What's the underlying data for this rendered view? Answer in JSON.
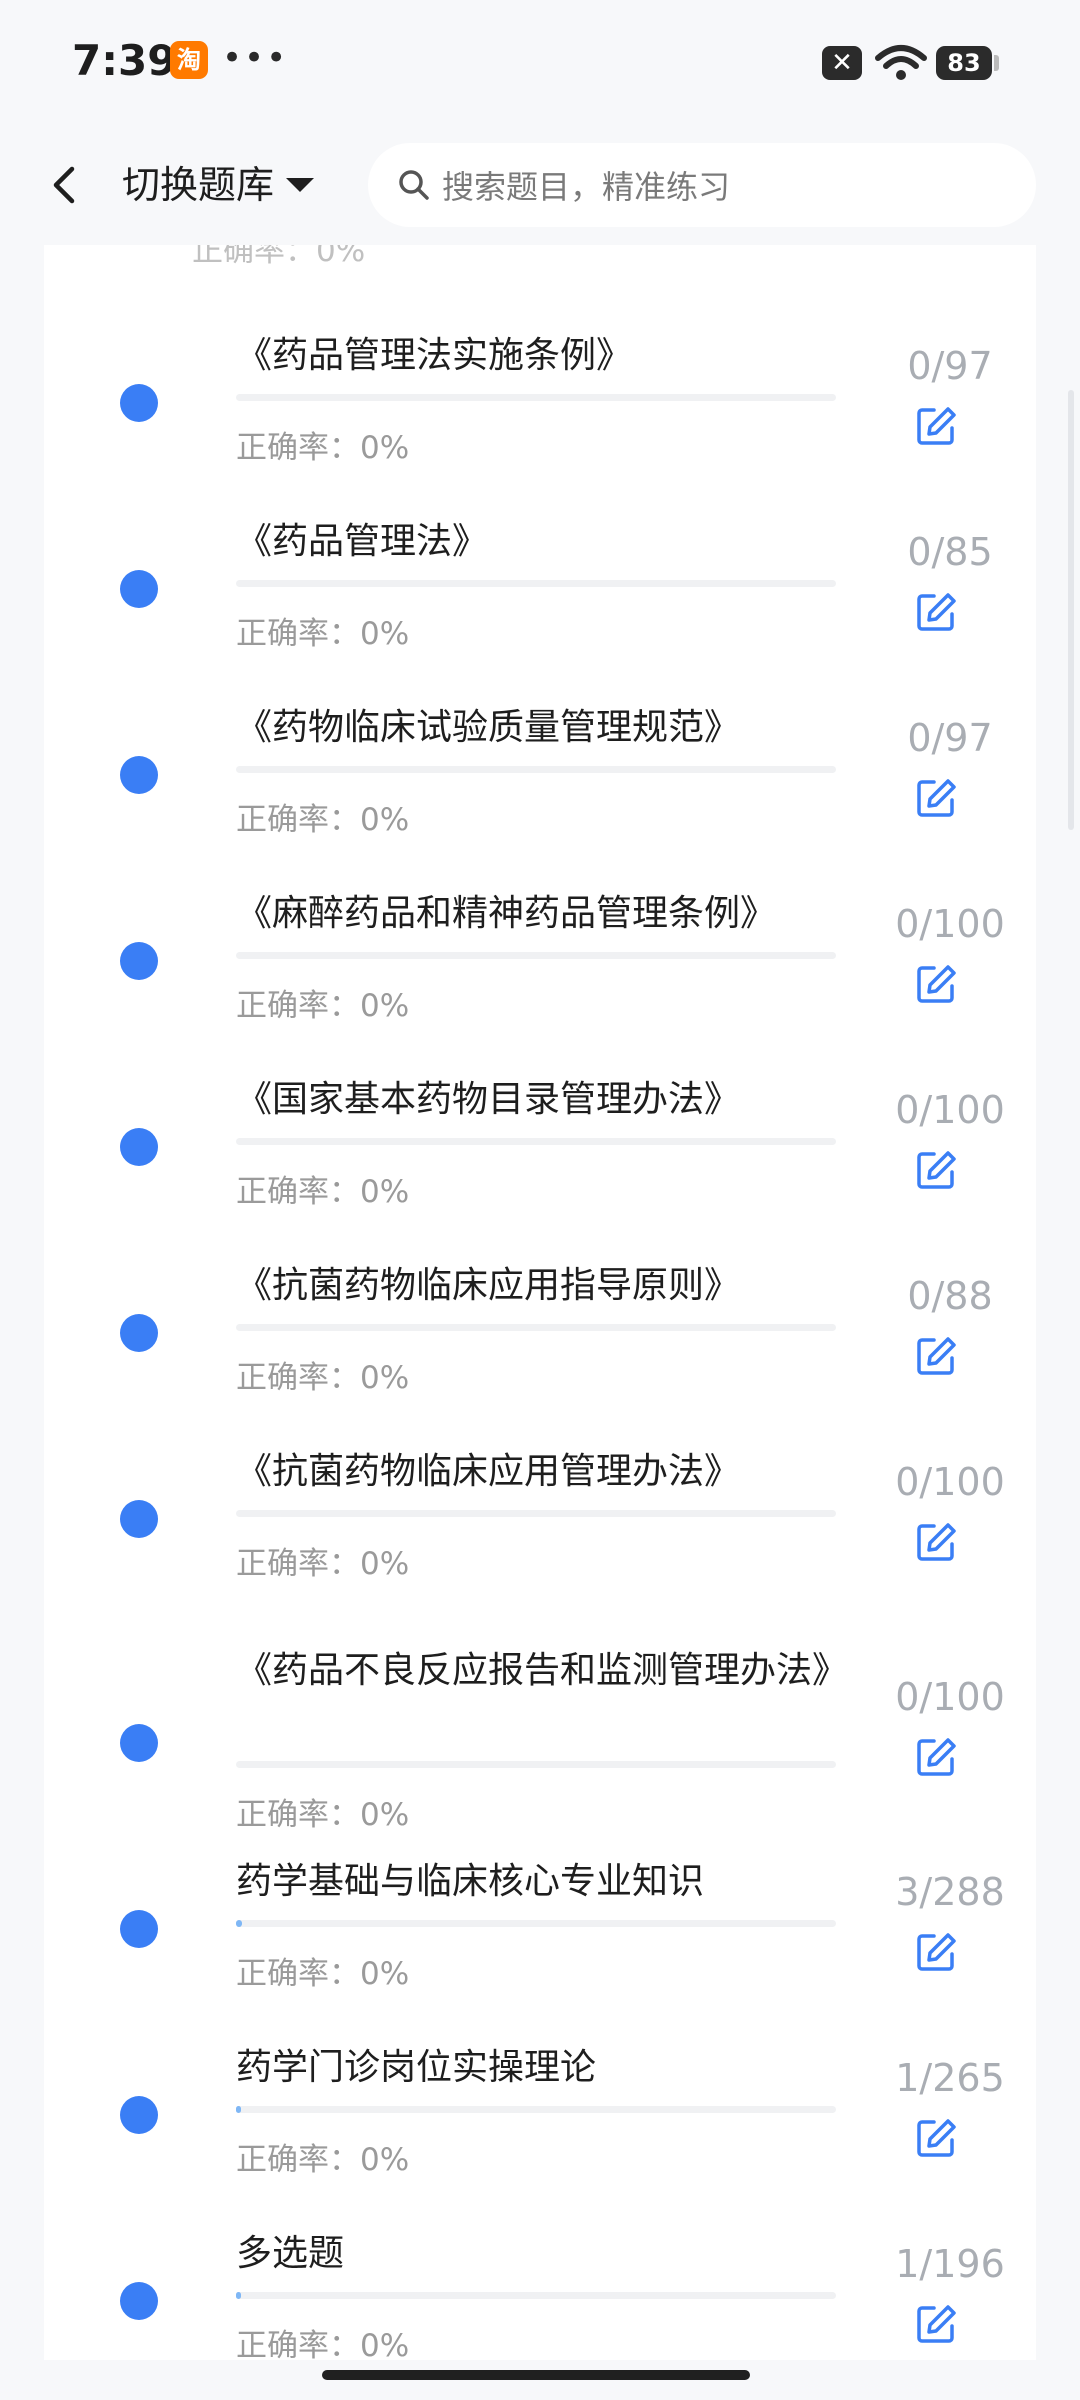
{
  "status": {
    "time": "7:39",
    "app_badge": "淘",
    "more_dots": "•••",
    "battery": "83"
  },
  "header": {
    "title": "切换题库",
    "search_placeholder": "搜索题目，精准练习"
  },
  "rate_label": "正确率：0%",
  "items": [
    {
      "title": "《药品管理法实施条例》",
      "count": "0/97",
      "progress": 0
    },
    {
      "title": "《药品管理法》",
      "count": "0/85",
      "progress": 0
    },
    {
      "title": "《药物临床试验质量管理规范》",
      "count": "0/97",
      "progress": 0
    },
    {
      "title": "《麻醉药品和精神药品管理条例》",
      "count": "0/100",
      "progress": 0
    },
    {
      "title": "《国家基本药物目录管理办法》",
      "count": "0/100",
      "progress": 0
    },
    {
      "title": "《抗菌药物临床应用指导原则》",
      "count": "0/88",
      "progress": 0
    },
    {
      "title": "《抗菌药物临床应用管理办法》",
      "count": "0/100",
      "progress": 0
    },
    {
      "title": "《药品不良反应报告和监测管理办法》",
      "count": "0/100",
      "progress": 0
    },
    {
      "title": "药学基础与临床核心专业知识",
      "count": "3/288",
      "progress": 0.0104
    },
    {
      "title": "药学门诊岗位实操理论",
      "count": "1/265",
      "progress": 0.0038
    },
    {
      "title": "多选题",
      "count": "1/196",
      "progress": 0.0051
    }
  ],
  "colors": {
    "dot": "#3a7ef5",
    "edit_icon": "#3a7ef5",
    "count": "#a9adb3",
    "progress": "#7fb7f5"
  }
}
